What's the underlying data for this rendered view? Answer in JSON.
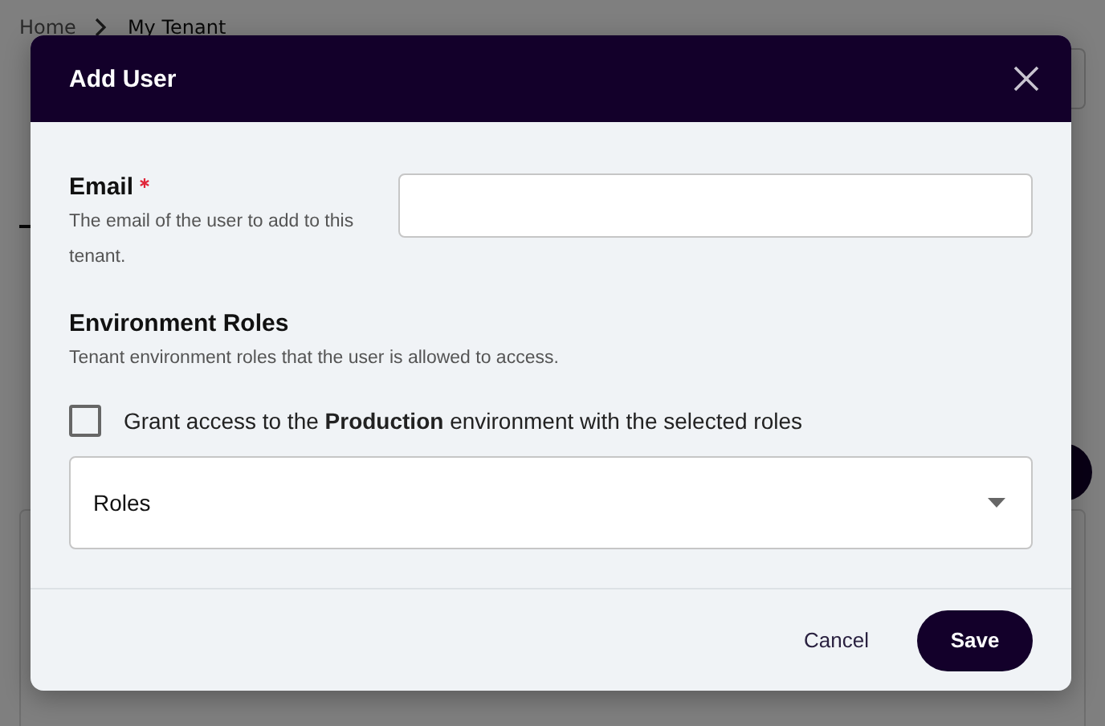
{
  "page": {
    "breadcrumb": [
      {
        "label": "Home"
      },
      {
        "label": "My Tenant"
      }
    ]
  },
  "dialog": {
    "title": "Add User",
    "email": {
      "label": "Email",
      "required": true,
      "help": "The email of the user to add to this tenant."
    },
    "roles": {
      "title": "Environment Roles",
      "help": "Tenant environment roles that the user is allowed to access.",
      "grant": {
        "label": "Grant access to the **Production** environment with the selected roles",
        "checked": false
      },
      "select": {
        "placeholder": "Roles"
      }
    },
    "buttons": [
      {
        "label": "Cancel",
        "kind": "text"
      },
      {
        "label": "Save",
        "kind": "primary"
      }
    ]
  }
}
